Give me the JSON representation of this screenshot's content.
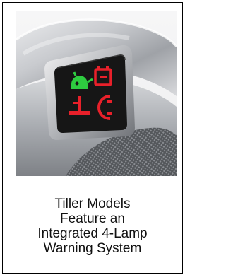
{
  "caption": {
    "lines": [
      "Tiller Models",
      "Feature an",
      "Integrated 4-Lamp",
      "Warning System"
    ]
  },
  "photo": {
    "icons": [
      "oil-can-icon",
      "battery-icon",
      "temperature-icon",
      "brake-icon"
    ],
    "colors": {
      "oil_lamp": "#2ecc40",
      "warning_lamps": "#e8202a",
      "panel": "#161616",
      "housing": "#bfc1c4"
    }
  }
}
